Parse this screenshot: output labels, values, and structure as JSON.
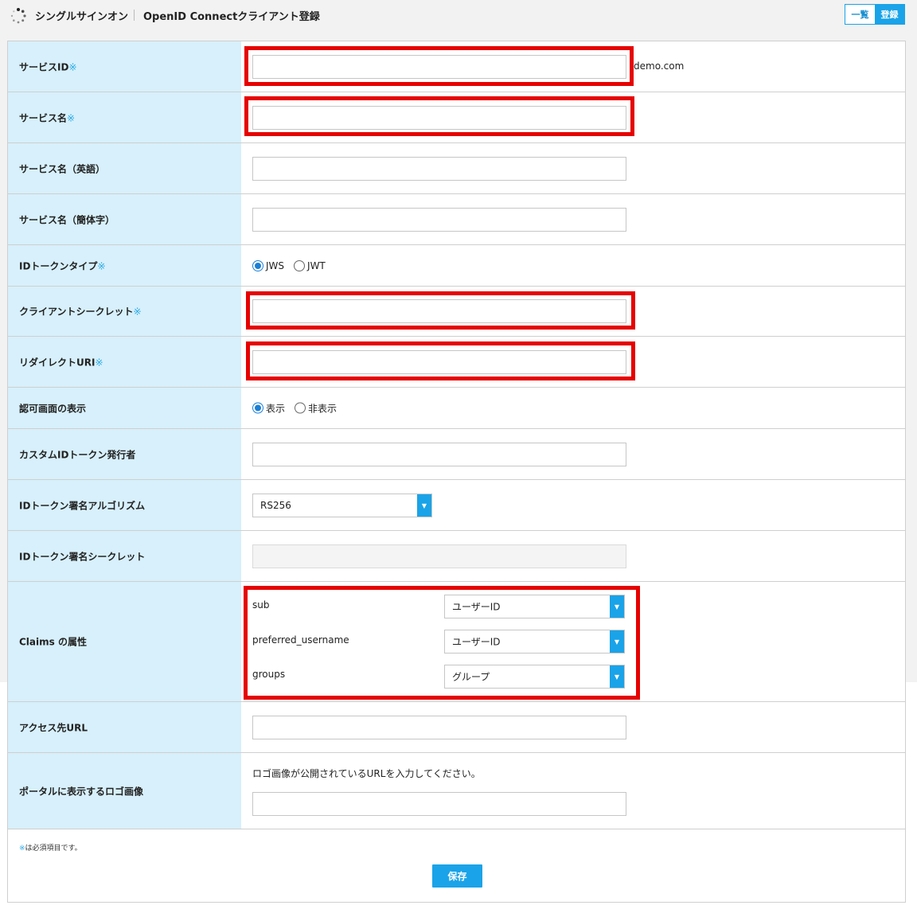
{
  "header": {
    "app_name": "シングルサインオン",
    "page_title": "OpenID Connectクライアント登録",
    "tab_list": "一覧",
    "tab_register": "登録"
  },
  "required_mark": "※",
  "form": {
    "service_id": {
      "label": "サービスID",
      "value": "",
      "suffix": "demo.com"
    },
    "service_name": {
      "label": "サービス名",
      "value": ""
    },
    "service_name_en": {
      "label": "サービス名（英語）",
      "value": ""
    },
    "service_name_zh": {
      "label": "サービス名（簡体字）",
      "value": ""
    },
    "id_token_type": {
      "label": "IDトークンタイプ",
      "options": [
        "JWS",
        "JWT"
      ],
      "selected": "JWS"
    },
    "client_secret": {
      "label": "クライアントシークレット",
      "value": ""
    },
    "redirect_uri": {
      "label": "リダイレクトURI",
      "value": ""
    },
    "consent_screen": {
      "label": "認可画面の表示",
      "options": [
        "表示",
        "非表示"
      ],
      "selected": "表示"
    },
    "custom_issuer": {
      "label": "カスタムIDトークン発行者",
      "value": ""
    },
    "sign_algorithm": {
      "label": "IDトークン署名アルゴリズム",
      "value": "RS256"
    },
    "sign_secret": {
      "label": "IDトークン署名シークレット",
      "value": ""
    },
    "claims": {
      "label": "Claims の属性",
      "items": [
        {
          "name": "sub",
          "value": "ユーザーID"
        },
        {
          "name": "preferred_username",
          "value": "ユーザーID"
        },
        {
          "name": "groups",
          "value": "グループ"
        }
      ]
    },
    "access_url": {
      "label": "アクセス先URL",
      "value": ""
    },
    "logo": {
      "label": "ポータルに表示するロゴ画像",
      "help": "ロゴ画像が公開されているURLを入力してください。",
      "value": ""
    }
  },
  "footer": {
    "required_note": "は必須項目です。",
    "save_label": "保存"
  },
  "colors": {
    "accent": "#1aa3e8",
    "label_bg": "#d7f0fb",
    "highlight": "#e60000",
    "required": "#29a9e6"
  }
}
